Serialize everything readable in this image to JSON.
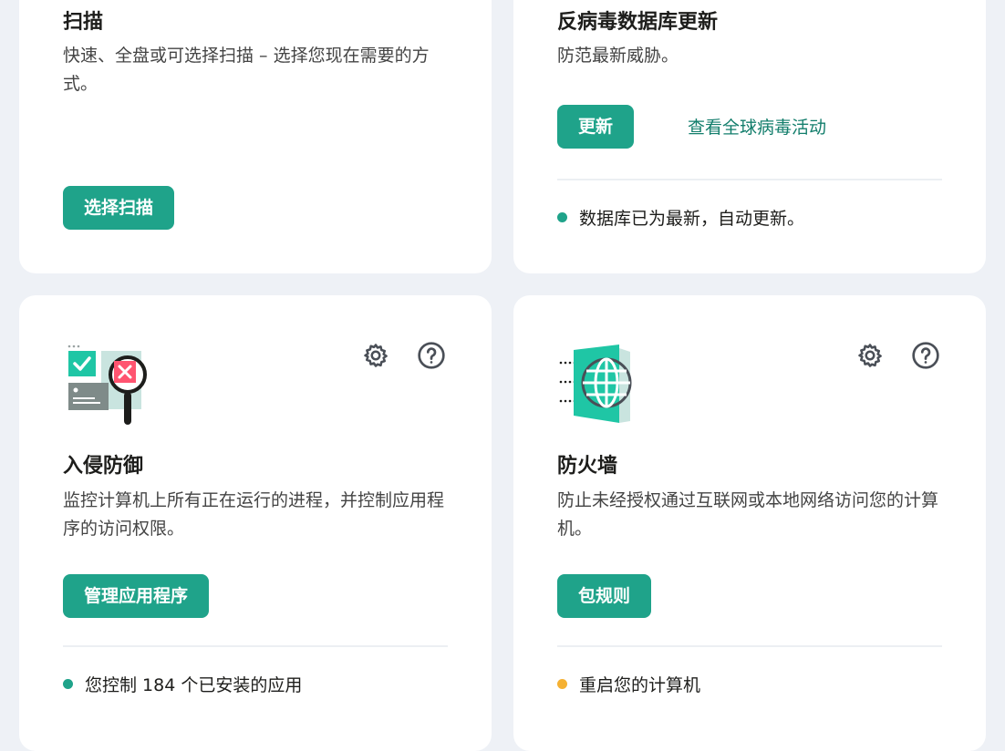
{
  "colors": {
    "accent": "#1fa38a",
    "link": "#137e6c",
    "status_ok": "#1fa38a",
    "status_warn": "#f5b133",
    "background": "#eef1f6"
  },
  "cards": {
    "scan": {
      "title": "扫描",
      "description": "快速、全盘或可选择扫描 – 选择您现在需要的方式。",
      "button": "选择扫描"
    },
    "update": {
      "title": "反病毒数据库更新",
      "description": "防范最新威胁。",
      "button": "更新",
      "link": "查看全球病毒活动",
      "status": "数据库已为最新，自动更新。"
    },
    "intrusion": {
      "title": "入侵防御",
      "description": "监控计算机上所有正在运行的进程，并控制应用程序的访问权限。",
      "button": "管理应用程序",
      "status": "您控制 184 个已安装的应用",
      "icons": [
        "settings-icon",
        "help-icon"
      ]
    },
    "firewall": {
      "title": "防火墙",
      "description": "防止未经授权通过互联网或本地网络访问您的计算机。",
      "button": "包规则",
      "status": "重启您的计算机",
      "icons": [
        "settings-icon",
        "help-icon"
      ]
    }
  }
}
